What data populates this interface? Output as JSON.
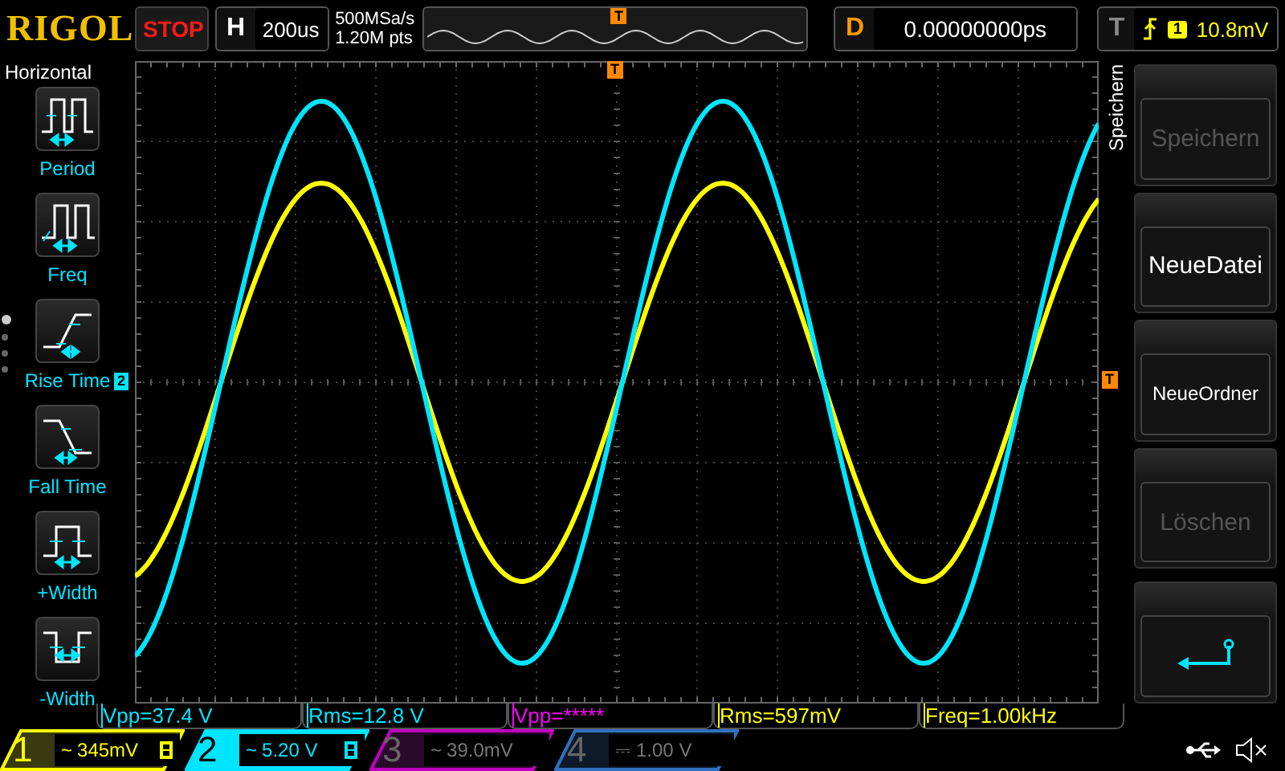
{
  "header": {
    "logo": "RIGOL",
    "run_state": "STOP",
    "timebase": {
      "label": "H",
      "value": "200us"
    },
    "sample_rate": "500MSa/s",
    "memory_depth": "1.20M pts",
    "overview_marker": "T",
    "delay": {
      "label": "D",
      "value": "0.00000000ps"
    },
    "trigger": {
      "label": "T",
      "source": "1",
      "level": "10.8mV"
    }
  },
  "left_menu": {
    "title": "Horizontal",
    "page_dots": [
      {
        "selected": true
      },
      {
        "selected": false
      },
      {
        "selected": false
      },
      {
        "selected": false
      }
    ],
    "items": [
      {
        "label": "Period",
        "kind": "period"
      },
      {
        "label": "Freq",
        "kind": "freq"
      },
      {
        "label": "Rise Time",
        "kind": "rise"
      },
      {
        "label": "Fall Time",
        "kind": "fall"
      },
      {
        "label": "+Width",
        "kind": "pwidth"
      },
      {
        "label": "-Width",
        "kind": "nwidth"
      }
    ]
  },
  "plot": {
    "channel_marker": "2",
    "trigger_position_marker": "T",
    "trigger_level_marker": "T"
  },
  "right_menu": {
    "title": "Speichern",
    "buttons": [
      {
        "kind": "text",
        "label": "Speichern",
        "disabled": true
      },
      {
        "kind": "text",
        "label": "NeueDatei",
        "disabled": false
      },
      {
        "kind": "text",
        "label": "NeueOrdner",
        "disabled": false
      },
      {
        "kind": "text",
        "label": "Löschen",
        "disabled": true
      },
      {
        "kind": "spacer"
      },
      {
        "kind": "back",
        "disabled": false
      }
    ]
  },
  "measurements": [
    {
      "text": "Vpp=37.4 V",
      "color": "#00e5ff"
    },
    {
      "text": "Rms=12.8 V",
      "color": "#00e5ff"
    },
    {
      "text": "Vpp=*****",
      "color": "#ff00ff"
    },
    {
      "text": "Rms=597mV",
      "color": "#ffff00"
    },
    {
      "text": "Freq=1.00kHz",
      "color": "#ffff00"
    }
  ],
  "channels": [
    {
      "number": "1",
      "coupling": "~",
      "scale": "345mV",
      "enabled": true,
      "selected": false,
      "bw_limit": true,
      "color": "#ffff00"
    },
    {
      "number": "2",
      "coupling": "~",
      "scale": "5.20 V",
      "enabled": true,
      "selected": true,
      "bw_limit": true,
      "color": "#00e5ff"
    },
    {
      "number": "3",
      "coupling": "~",
      "scale": "39.0mV",
      "enabled": false,
      "selected": false,
      "bw_limit": false,
      "color": "#c000c0"
    },
    {
      "number": "4",
      "coupling": "⎓",
      "scale": "1.00 V",
      "enabled": false,
      "selected": false,
      "bw_limit": false,
      "color": "#3070c0"
    }
  ],
  "status": {
    "usb_connected": true,
    "sound_muted": true
  }
}
